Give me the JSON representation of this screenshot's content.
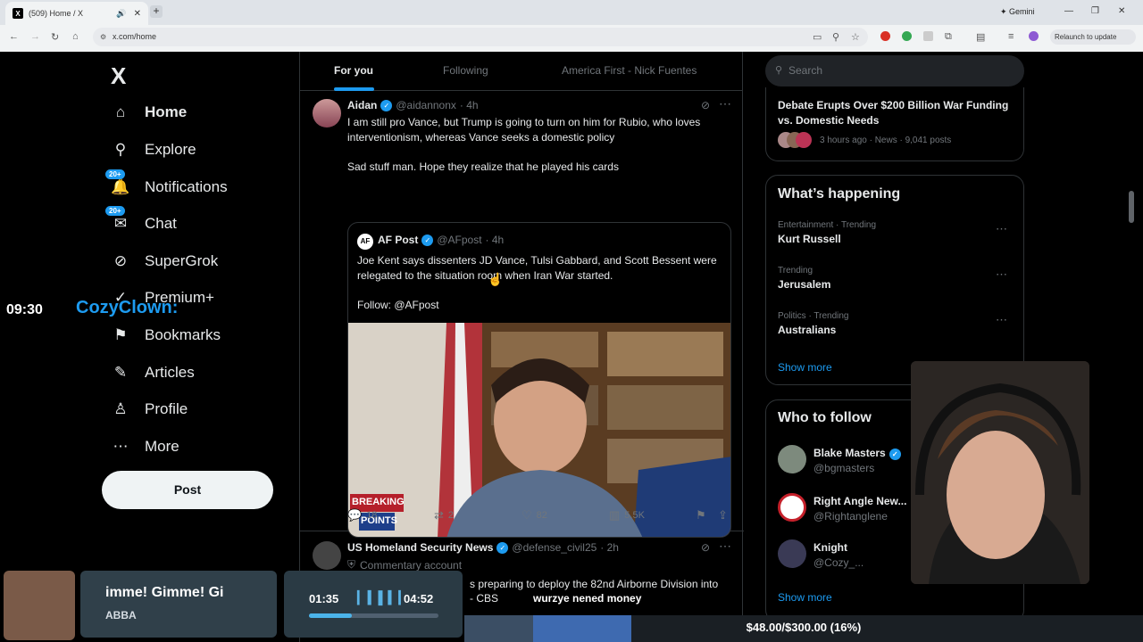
{
  "browser": {
    "tab_title": "(509) Home / X",
    "tab_favicon": "X",
    "url": "x.com/home",
    "gemini_label": "Gemini",
    "relaunch_label": "Relaunch to update"
  },
  "sidebar": {
    "logo": "X",
    "items": [
      {
        "label": "Home",
        "icon": "home-icon",
        "glyph": "⌂",
        "bold": true
      },
      {
        "label": "Explore",
        "icon": "search-icon",
        "glyph": "⚲"
      },
      {
        "label": "Notifications",
        "icon": "bell-icon",
        "glyph": "🔔",
        "badge": "20+"
      },
      {
        "label": "Chat",
        "icon": "mail-icon",
        "glyph": "✉",
        "badge": "20+"
      },
      {
        "label": "SuperGrok",
        "icon": "grok-icon",
        "glyph": "⊘"
      },
      {
        "label": "Premium+",
        "icon": "premium-icon",
        "glyph": "✓"
      },
      {
        "label": "Bookmarks",
        "icon": "bookmark-icon",
        "glyph": "⚑"
      },
      {
        "label": "Articles",
        "icon": "article-icon",
        "glyph": "✎"
      },
      {
        "label": "Profile",
        "icon": "person-icon",
        "glyph": "♙"
      },
      {
        "label": "More",
        "icon": "more-icon",
        "glyph": "⋯"
      }
    ],
    "post_button": "Post"
  },
  "feed": {
    "tabs": [
      "For you",
      "Following",
      "America First - Nick Fuentes"
    ],
    "active_tab": "For you",
    "tweet1": {
      "name": "Aidan",
      "handle": "@aidannonx",
      "time": "· 4h",
      "text1": "I am still pro Vance, but Trump is going to turn on him for Rubio, who loves interventionism, whereas Vance seeks a domestic policy",
      "text2": "Sad stuff man. Hope they realize that he played his cards",
      "quote": {
        "avatar_text": "AF",
        "name": "AF Post",
        "handle": "@AFpost",
        "time": "· 4h",
        "text1": "Joe Kent says dissenters JD Vance, Tulsi Gabbard, and Scott Bessent were relegated to the situation room when Iran War started.",
        "text2": "Follow: @AFpost",
        "image_label_1": "BREAKING",
        "image_label_2": "POINTS"
      },
      "replies": "18",
      "reposts": "2",
      "likes": "82",
      "views": "5.5K"
    },
    "tweet2": {
      "name": "US Homeland Security News",
      "handle": "@defense_civil25",
      "time": "· 2h",
      "label": "Commentary account",
      "text": "s preparing to deploy the 82nd Airborne Division into",
      "text_line2": "- CBS"
    }
  },
  "right": {
    "search_placeholder": "Search",
    "top_trend": {
      "title": "Debate Erupts Over $200 Billion War Funding vs. Domestic Needs",
      "meta": "3 hours ago · News · 9,041 posts"
    },
    "happening_title": "What’s happening",
    "trends": [
      {
        "meta": "Entertainment · Trending",
        "name": "Kurt Russell"
      },
      {
        "meta": "Trending",
        "name": "Jerusalem"
      },
      {
        "meta": "Politics · Trending",
        "name": "Australians"
      }
    ],
    "show_more": "Show more",
    "who_title": "Who to follow",
    "follow": [
      {
        "name": "Blake Masters",
        "handle": "@bgmasters"
      },
      {
        "name": "Right Angle New...",
        "handle": "@Rightanglene"
      },
      {
        "name": "Knight",
        "handle": "@Cozy_..."
      }
    ],
    "show_more_2": "Show more"
  },
  "overlay": {
    "time": "09:30",
    "user": "CozyClown:",
    "song_title": "imme! Gimme! Gi",
    "song_artist": "ABBA",
    "elapsed": "01:35",
    "duration": "04:52",
    "progress": 0.33,
    "caption": "wurzye nened money",
    "goal": "$48.00/$300.00 (16%)",
    "goal_fraction": 0.16
  },
  "colors": {
    "accent": "#1d9bf0",
    "bg": "#000000",
    "border": "#2f3336"
  }
}
